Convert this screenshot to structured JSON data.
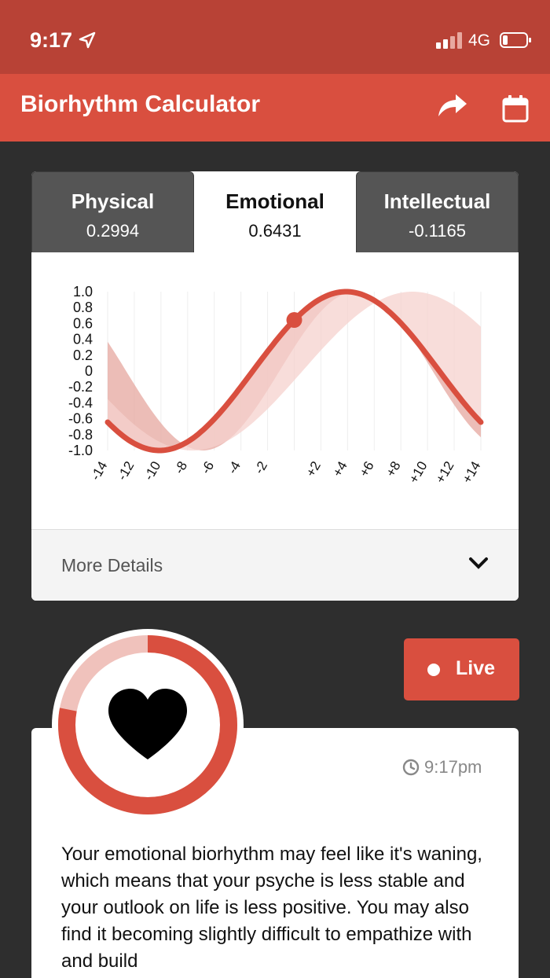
{
  "status_bar": {
    "time": "9:17",
    "network": "4G",
    "icons": [
      "location-arrow-icon",
      "signal-bars-icon",
      "battery-icon"
    ]
  },
  "header": {
    "title": "Biorhythm Calculator",
    "icons": [
      "share-icon",
      "calendar-icon"
    ]
  },
  "tabs": [
    {
      "label": "Physical",
      "value": "0.2994",
      "active": false
    },
    {
      "label": "Emotional",
      "value": "0.6431",
      "active": true
    },
    {
      "label": "Intellectual",
      "value": "-0.1165",
      "active": false
    }
  ],
  "chart_data": {
    "type": "line",
    "x": [
      -14,
      14
    ],
    "y_ticks": [
      "1.0",
      "0.8",
      "0.6",
      "0.4",
      "0.2",
      "0",
      "-0.2",
      "-0.4",
      "-0.6",
      "-0.8",
      "-1.0"
    ],
    "x_ticks": [
      "-14",
      "-12",
      "-10",
      "-8",
      "-6",
      "-4",
      "-2",
      "+2",
      "+4",
      "+6",
      "+8",
      "+10",
      "+12",
      "+14"
    ],
    "ylim": [
      -1,
      1
    ],
    "xlim": [
      -14,
      14
    ],
    "series": [
      {
        "period": 28,
        "current": 0.6431,
        "role": "highlighted-line"
      },
      {
        "period": 23,
        "current": 0.2994,
        "role": "background-band"
      },
      {
        "period": 33,
        "current": -0.1165,
        "role": "background-band"
      }
    ],
    "colors": {
      "line": "#d94f3f",
      "band_dark": "#e6a79f",
      "band_light": "#f5d2cd"
    }
  },
  "details": {
    "label": "More Details",
    "icon": "chevron-down-icon"
  },
  "live_button": {
    "label": "Live"
  },
  "gauge": {
    "icon": "heart-icon",
    "fill_fraction": 0.78,
    "colors": {
      "track": "#f0c2bc",
      "fill": "#d94f3f"
    }
  },
  "info": {
    "time": "9:17pm",
    "time_icon": "clock-icon",
    "text": "Your emotional biorhythm may feel like it's waning, which means that your psyche is less stable and your outlook on life is less positive. You may also find it becoming slightly difficult to empathize with and build"
  }
}
